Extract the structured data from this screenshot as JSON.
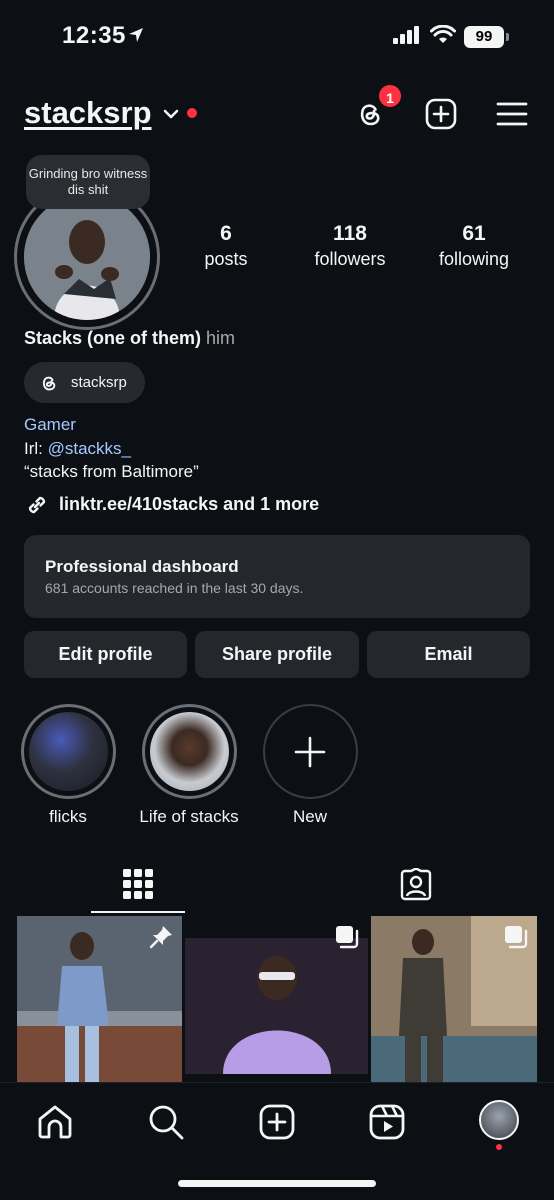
{
  "status_bar": {
    "time": "12:35",
    "battery": "99"
  },
  "header": {
    "username": "stacksrp",
    "threads_badge": "1"
  },
  "note": "Grinding bro witness dis shit",
  "stats": [
    {
      "num": "6",
      "label": "posts"
    },
    {
      "num": "118",
      "label": "followers"
    },
    {
      "num": "61",
      "label": "following"
    }
  ],
  "profile": {
    "display_name": "Stacks (one of them)",
    "pronouns": "him",
    "threads_handle": "stacksrp",
    "category": "Gamer",
    "bio_prefix": "Irl: ",
    "bio_mention": "@stackks_",
    "bio_line2": "“stacks from Baltimore”",
    "link": "linktr.ee/410stacks and 1 more"
  },
  "dashboard": {
    "title": "Professional dashboard",
    "subtitle": "681 accounts reached in the last 30 days."
  },
  "buttons": {
    "edit": "Edit profile",
    "share": "Share profile",
    "email": "Email"
  },
  "highlights": [
    {
      "label": "flicks"
    },
    {
      "label": "Life of stacks"
    },
    {
      "label": "New"
    }
  ],
  "colors": {
    "background": "#0c1014",
    "accent_blue": "#a6c8ff",
    "badge_red": "#ff3040",
    "surface": "#24272c"
  },
  "icons": {
    "header": [
      "threads-icon",
      "new-post-icon",
      "menu-icon"
    ],
    "tabs": [
      "grid-icon",
      "tagged-icon"
    ],
    "nav": [
      "home-icon",
      "search-icon",
      "create-icon",
      "reels-icon",
      "profile-avatar"
    ]
  }
}
